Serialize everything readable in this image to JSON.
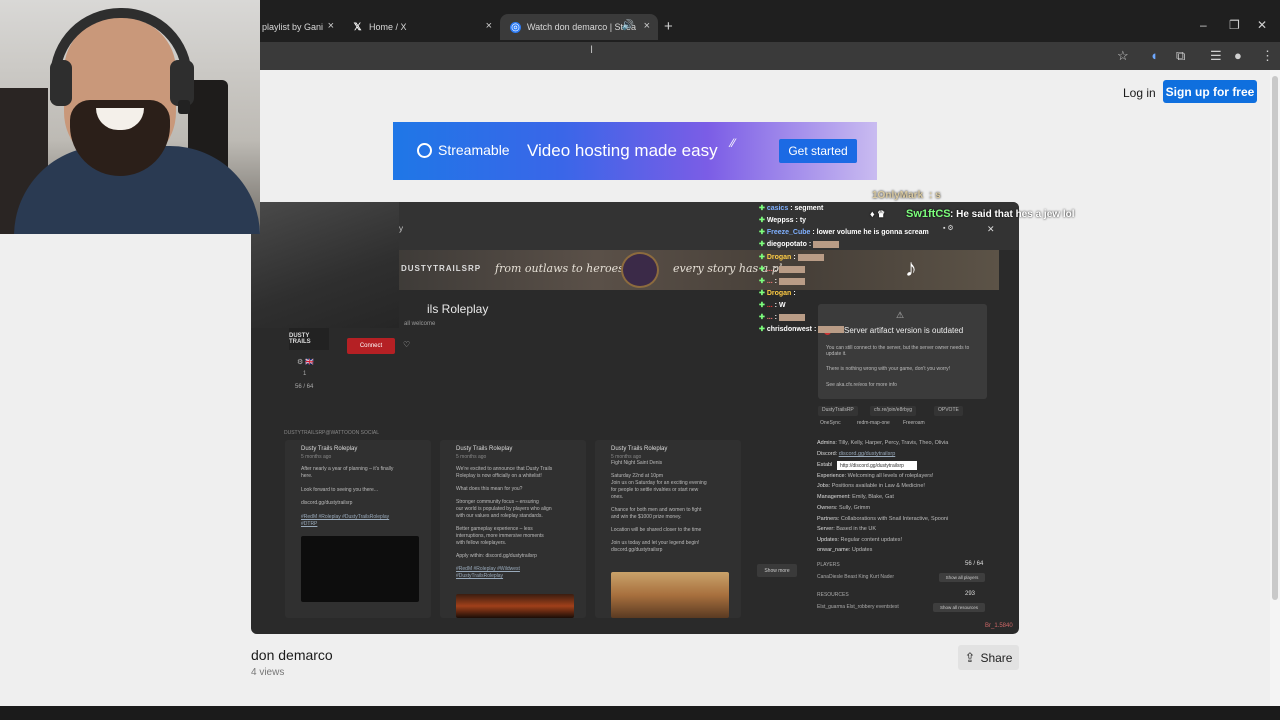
{
  "browser": {
    "tabs": [
      {
        "label": "playlist by Gani",
        "close": "×"
      },
      {
        "label": "Home / X",
        "icon": "𝕏",
        "close": "×"
      },
      {
        "label": "Watch don demarco | Strea",
        "icon": "◎",
        "close": "×",
        "speaker": "🔊"
      }
    ],
    "new_tab": "+",
    "window_controls": [
      "–",
      "❐",
      "✕"
    ]
  },
  "header": {
    "login": "Log in",
    "signup": "Sign up for free"
  },
  "banner": {
    "brand": "Streamable",
    "tagline": "Video hosting made easy",
    "cta": "Get started"
  },
  "video": {
    "tiktok": "♪",
    "stream": {
      "title": "ils Roleplay",
      "subtitle": "all welcome",
      "header_letter": "y",
      "strip_logo": "DUSTYTRAILSRP",
      "strip_a": "from outlaws to heroes",
      "strip_b": "every story has a place",
      "server_logo": "DUSTY TRAILS",
      "connect": "Connect",
      "meta_players": "56 / 64",
      "meta_one": "1",
      "flags": "⚙ 🇬🇧",
      "social_label": "DUSTYTRAILSRP@WATTOOON SOCIAL",
      "show_more": "Show more"
    },
    "posts": [
      {
        "author": "Dusty Trails Roleplay",
        "date": "5 months ago",
        "lines": [
          "After nearly a year of planning – it's finally",
          "here.",
          "",
          "Look forward to seeing you there...",
          "",
          "discord.gg/dustytrailsrp",
          "",
          "#RedM #Roleplay #DustyTrailsRoleplay",
          "#DTRP"
        ]
      },
      {
        "author": "Dusty Trails Roleplay",
        "date": "5 months ago",
        "lines": [
          "We're excited to announce that Dusty Trails",
          "Roleplay is now officially on a whitelist!",
          "",
          "What does this mean for you?",
          "",
          "Stronger community focus – ensuring",
          "our world is populated by players who align",
          "with our values and roleplay standards.",
          "",
          "Better gameplay experience – less",
          "interruptions, more immersive moments",
          "with fellow roleplayers.",
          "",
          "Apply within: discord.gg/dustytrailsrp",
          "",
          "#RedM #Roleplay #Wildwest",
          "#DustyTrailsRoleplay"
        ]
      },
      {
        "author": "Dusty Trails Roleplay",
        "date": "5 months ago",
        "lines": [
          "Fight Night Saint Denis",
          "",
          "Saturday 22nd at 10pm",
          "Join us on Saturday for an exciting evening",
          "for people to settle rivalries or start new",
          "ones.",
          "",
          "Chance for both men and women to fight",
          "and win the $1000 prize money.",
          "",
          "Location will be shared closer to the time",
          "",
          "Join us today and let your legend begin!",
          "discord.gg/dustytrailsrp"
        ]
      }
    ],
    "popup": {
      "title": "Server artifact version is outdated",
      "p1": "You can still connect to the server, but the server owner needs to update it.",
      "p2": "There is nothing wrong with your game, don't you worry!",
      "p3": "See aka.cfx.re/eos for more info"
    },
    "tags": [
      "DustyTrailsRP",
      "cfx.re/join/e8rbyg",
      "OPVOTE"
    ],
    "tags2": [
      "OneSync",
      "redm-map-one",
      "Freeroam"
    ],
    "info": [
      {
        "k": "Admins:",
        "v": "Tilly, Kelly, Harper, Percy, Travis, Theo, Olivia"
      },
      {
        "k": "Discord:",
        "v": "discord.gg/dustytrailsrp",
        "link": true
      },
      {
        "k": "Establ",
        "v": ""
      },
      {
        "k": "Experience:",
        "v": "Welcoming all levels of roleplayers!"
      },
      {
        "k": "Jobs:",
        "v": "Positions available in Law & Medicine!"
      },
      {
        "k": "Management:",
        "v": "Emily, Blake, Gat"
      },
      {
        "k": "Owners:",
        "v": "Sully, Grimm"
      },
      {
        "k": "Partners:",
        "v": "Collaborations with Snail Interactive, Spooni"
      },
      {
        "k": "Server:",
        "v": "Based in the UK"
      },
      {
        "k": "Updates:",
        "v": "Regular content updates!"
      },
      {
        "k": "onwar_name:",
        "v": "Updates"
      }
    ],
    "tooltip": "http://discord.gg/dustytrailsrp",
    "players_label": "PLAYERS",
    "players_value": "56 / 64",
    "players_names": "CanaDiesle    Beast    King    Kurt Nader",
    "show_players": "Show all players",
    "resources_label": "RESOURCES",
    "resources_value": "293",
    "resources_names": "Elst_guarma    Elst_robbery    eventstest",
    "show_resources": "Show all resources",
    "watermark": "Br_1.5840"
  },
  "chat": [
    {
      "user": "casics",
      "msg": "segment",
      "color": "#7fb0ff",
      "blur": false
    },
    {
      "user": "Weppss",
      "msg": "ty",
      "color": "#ffffff",
      "blur": false
    },
    {
      "user": "Freeze_Cube",
      "msg": "lower volume he is gonna scream",
      "color": "#7fb0ff",
      "blur": false
    },
    {
      "user": "diegopotato",
      "msg": "",
      "color": "#ffffff",
      "blur": true
    },
    {
      "user": "Drogan",
      "msg": "",
      "color": "#ffcc44",
      "blur": true
    },
    {
      "user": "...",
      "msg": "",
      "color": "#ff7a7a",
      "blur": true
    },
    {
      "user": "...",
      "msg": "",
      "color": "#ff7a7a",
      "blur": true
    },
    {
      "user": "Drogan",
      "msg": "",
      "color": "#ffcc44",
      "blur": false
    },
    {
      "user": "...",
      "msg": "W",
      "color": "#ff3b3b",
      "blur": false
    },
    {
      "user": "...",
      "msg": "",
      "color": "#ff7a7a",
      "blur": true
    },
    {
      "user": "chrisdonwest",
      "msg": "",
      "color": "#ffffff",
      "blur": true
    }
  ],
  "chat_overlay": {
    "user1": "1OnlyMark",
    "msg1": ": s",
    "user2": "Sw1ftCS",
    "msg2": ": He said that hes a jew lol"
  },
  "page": {
    "title": "don demarco",
    "views": "4 views",
    "share": "Share"
  },
  "colors": {
    "accent": "#0f6fde",
    "page_bg": "#efefef"
  }
}
